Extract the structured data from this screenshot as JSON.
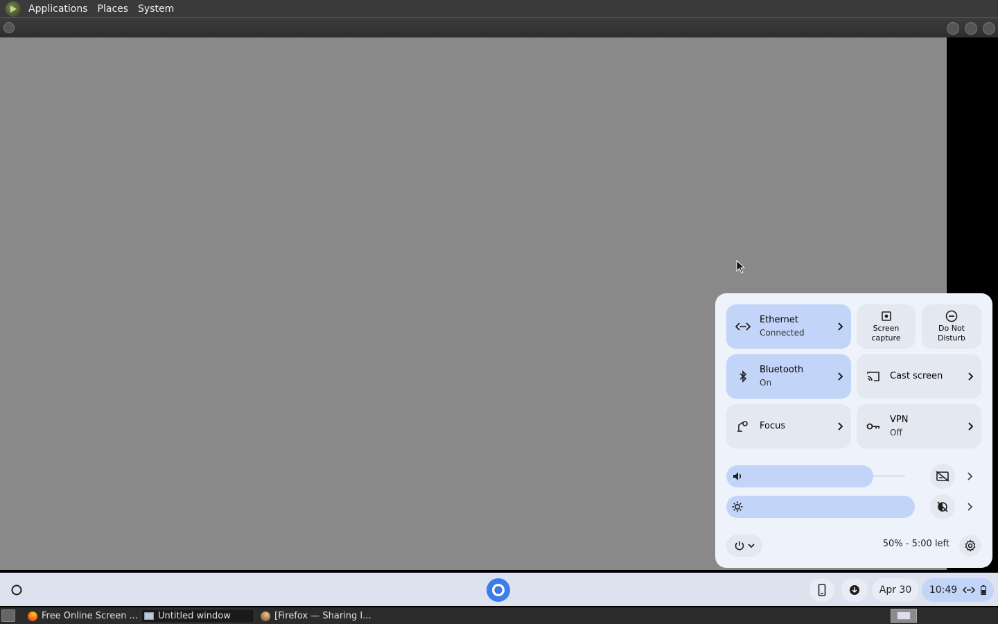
{
  "top_panel": {
    "menus": [
      "Applications",
      "Places",
      "System"
    ]
  },
  "quick_settings": {
    "ethernet": {
      "title": "Ethernet",
      "status": "Connected"
    },
    "screen_capture": {
      "line1": "Screen",
      "line2": "capture"
    },
    "do_not_disturb": {
      "line1": "Do Not",
      "line2": "Disturb"
    },
    "bluetooth": {
      "title": "Bluetooth",
      "status": "On"
    },
    "cast_screen": {
      "title": "Cast screen"
    },
    "focus": {
      "title": "Focus"
    },
    "vpn": {
      "title": "VPN",
      "status": "Off"
    },
    "volume_level": 0.82,
    "brightness_level": 1.0,
    "battery_text": "50% - 5:00 left"
  },
  "shelf": {
    "date": "Apr 30",
    "time": "10:49"
  },
  "taskbar": {
    "tasks": [
      {
        "label": "Free Online Screen ..."
      },
      {
        "label": "Untitled window"
      },
      {
        "label": "[Firefox — Sharing I..."
      }
    ]
  },
  "colors": {
    "accent": "#c2d4f8",
    "panel_bg": "#eef2fa",
    "screen_bg": "#898989"
  }
}
